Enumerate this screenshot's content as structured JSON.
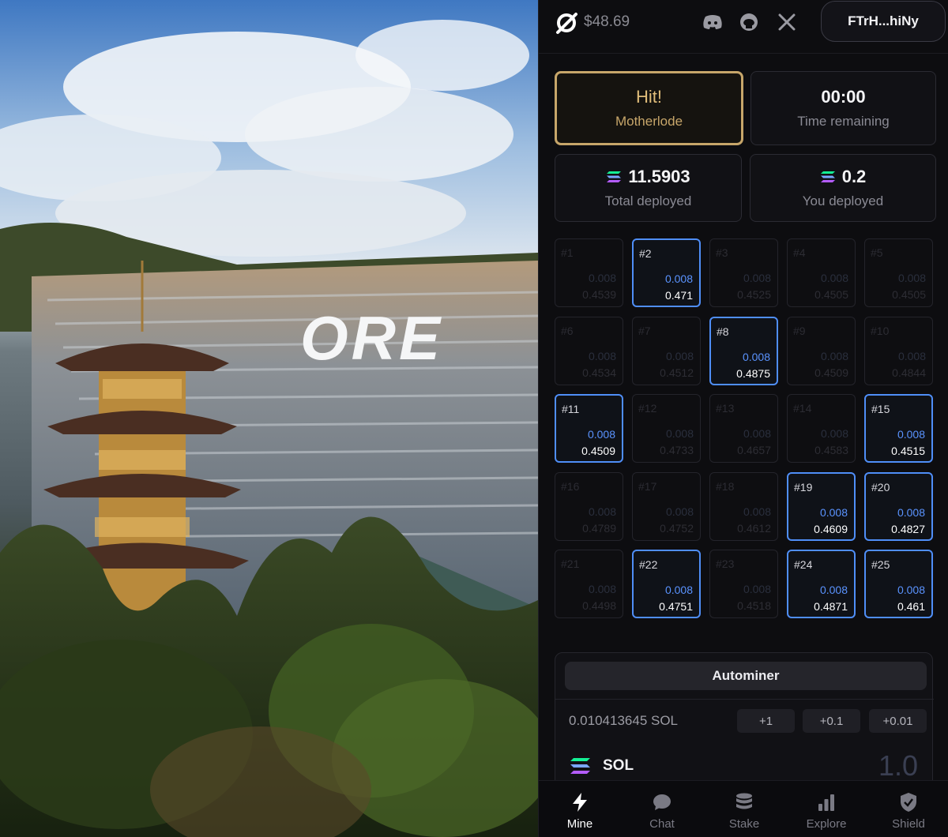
{
  "photo": {
    "sign_text": "ORE"
  },
  "header": {
    "price": "$48.69",
    "wallet": "FTrH...hiNy",
    "social_icons": [
      "discord-icon",
      "github-icon",
      "x-icon"
    ]
  },
  "round": {
    "status_title": "Hit!",
    "status_subtitle": "Motherlode",
    "timer": "00:00",
    "timer_label": "Time remaining",
    "total_deployed": "11.5903",
    "total_deployed_label": "Total deployed",
    "you_deployed": "0.2",
    "you_deployed_label": "You deployed"
  },
  "blocks": [
    {
      "label": "#1",
      "amount": "0.008",
      "odds": "0.4539",
      "selected": false
    },
    {
      "label": "#2",
      "amount": "0.008",
      "odds": "0.471",
      "selected": true
    },
    {
      "label": "#3",
      "amount": "0.008",
      "odds": "0.4525",
      "selected": false
    },
    {
      "label": "#4",
      "amount": "0.008",
      "odds": "0.4505",
      "selected": false
    },
    {
      "label": "#5",
      "amount": "0.008",
      "odds": "0.4505",
      "selected": false
    },
    {
      "label": "#6",
      "amount": "0.008",
      "odds": "0.4534",
      "selected": false
    },
    {
      "label": "#7",
      "amount": "0.008",
      "odds": "0.4512",
      "selected": false
    },
    {
      "label": "#8",
      "amount": "0.008",
      "odds": "0.4875",
      "selected": true
    },
    {
      "label": "#9",
      "amount": "0.008",
      "odds": "0.4509",
      "selected": false
    },
    {
      "label": "#10",
      "amount": "0.008",
      "odds": "0.4844",
      "selected": false
    },
    {
      "label": "#11",
      "amount": "0.008",
      "odds": "0.4509",
      "selected": true
    },
    {
      "label": "#12",
      "amount": "0.008",
      "odds": "0.4733",
      "selected": false
    },
    {
      "label": "#13",
      "amount": "0.008",
      "odds": "0.4657",
      "selected": false
    },
    {
      "label": "#14",
      "amount": "0.008",
      "odds": "0.4583",
      "selected": false
    },
    {
      "label": "#15",
      "amount": "0.008",
      "odds": "0.4515",
      "selected": true
    },
    {
      "label": "#16",
      "amount": "0.008",
      "odds": "0.4789",
      "selected": false
    },
    {
      "label": "#17",
      "amount": "0.008",
      "odds": "0.4752",
      "selected": false
    },
    {
      "label": "#18",
      "amount": "0.008",
      "odds": "0.4612",
      "selected": false
    },
    {
      "label": "#19",
      "amount": "0.008",
      "odds": "0.4609",
      "selected": true
    },
    {
      "label": "#20",
      "amount": "0.008",
      "odds": "0.4827",
      "selected": true
    },
    {
      "label": "#21",
      "amount": "0.008",
      "odds": "0.4498",
      "selected": false
    },
    {
      "label": "#22",
      "amount": "0.008",
      "odds": "0.4751",
      "selected": true
    },
    {
      "label": "#23",
      "amount": "0.008",
      "odds": "0.4518",
      "selected": false
    },
    {
      "label": "#24",
      "amount": "0.008",
      "odds": "0.4871",
      "selected": true
    },
    {
      "label": "#25",
      "amount": "0.008",
      "odds": "0.461",
      "selected": true
    }
  ],
  "deploy": {
    "autominer_label": "Autominer",
    "balance": "0.010413645 SOL",
    "increments": [
      "+1",
      "+0.1",
      "+0.01"
    ],
    "token_name": "SOL",
    "amount_value": "1.0"
  },
  "nav": [
    {
      "label": "Mine",
      "icon": "bolt-icon",
      "active": true
    },
    {
      "label": "Chat",
      "icon": "chat-icon",
      "active": false
    },
    {
      "label": "Stake",
      "icon": "database-icon",
      "active": false
    },
    {
      "label": "Explore",
      "icon": "bar-chart-icon",
      "active": false
    },
    {
      "label": "Shield",
      "icon": "shield-icon",
      "active": false
    }
  ],
  "colors": {
    "accent_blue": "#4f8ef7",
    "accent_gold": "#c7a66a",
    "background": "#0d0d10"
  }
}
